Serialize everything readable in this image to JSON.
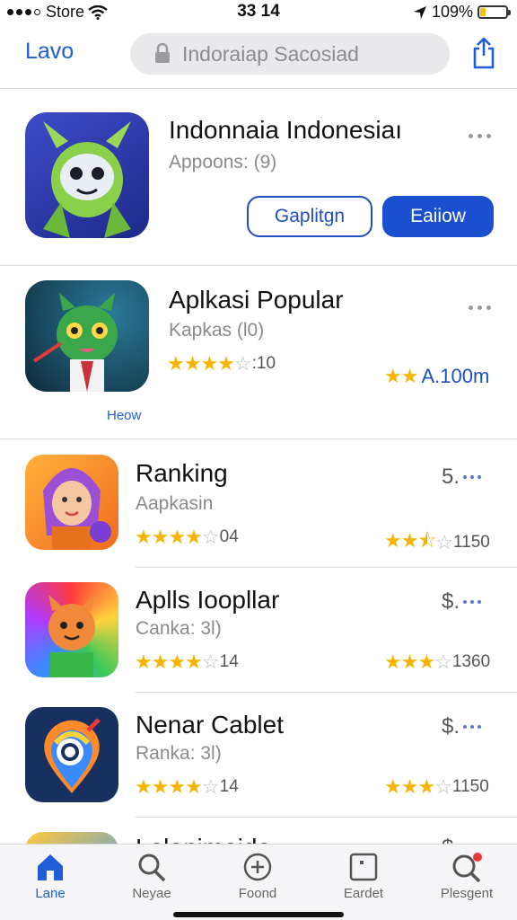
{
  "status_bar": {
    "carrier": "Store",
    "time": "33 14",
    "battery": "109%"
  },
  "nav": {
    "back_label": "Lavo",
    "search_placeholder": "Indoraiap Sacosiad"
  },
  "featured": {
    "title": "Indonnaia Indonesiaı",
    "subtitle": "Appoons: (9)",
    "outline_button": "Gaplitgn",
    "solid_button": "Eaiiow"
  },
  "popular": {
    "title": "Aplkasi Popular",
    "subtitle": "Kapkas (l0)",
    "rating_text": "10",
    "right_rating_text": "A.100m",
    "link": "Heow"
  },
  "apps": [
    {
      "title": "Ranking",
      "subtitle": "Aapkasin",
      "price": "5.",
      "rating_text": "04",
      "right_rating_text": "1150"
    },
    {
      "title": "Aplls Ioopllar",
      "subtitle": "Canka: 3l)",
      "price": "$.",
      "rating_text": "14",
      "right_rating_text": "1360"
    },
    {
      "title": "Nenar Cablet",
      "subtitle": "Ranka: 3l)",
      "price": "$.",
      "rating_text": "14",
      "right_rating_text": "1150"
    },
    {
      "title": "Lalanimaida",
      "subtitle": "",
      "price": "$."
    }
  ],
  "tabs": [
    {
      "label": "Lane",
      "icon": "home-icon"
    },
    {
      "label": "Neyae",
      "icon": "search-icon"
    },
    {
      "label": "Foond",
      "icon": "plus-circle-icon"
    },
    {
      "label": "Eardet",
      "icon": "card-icon"
    },
    {
      "label": "Plesgent",
      "icon": "search-badge-icon"
    }
  ],
  "colors": {
    "accent": "#1f5ed6",
    "star": "#f5b400",
    "badge": "#e53935"
  }
}
